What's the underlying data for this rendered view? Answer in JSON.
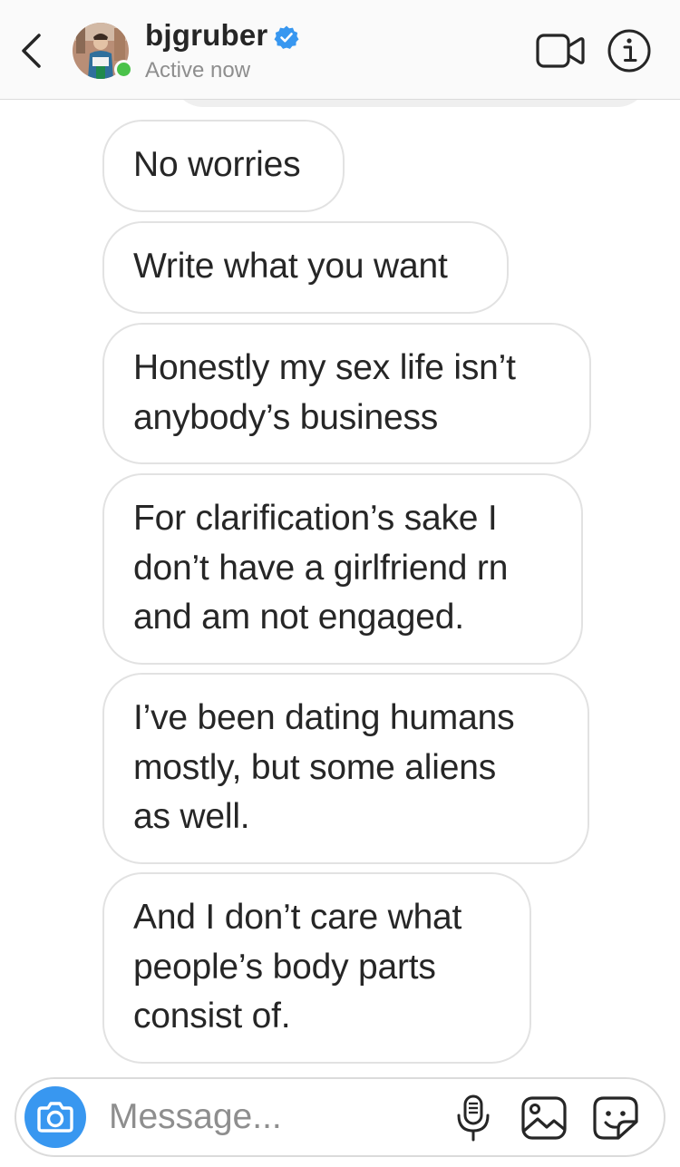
{
  "header": {
    "username": "bjgruber",
    "status": "Active now",
    "verified": true
  },
  "messages": [
    "No worries",
    "Write what you want",
    "Honestly my sex life isn’t\nanybody’s business",
    "For clarification’s sake I\ndon’t have a girlfriend rn\nand am not engaged.",
    "I’ve been dating humans\nmostly, but some aliens\nas well.",
    "And I don’t care what\npeople’s body parts\nconsist of."
  ],
  "composer": {
    "placeholder": "Message..."
  },
  "icons": {
    "back": "chevron-left-icon",
    "verified": "verified-badge-icon",
    "video": "video-camera-icon",
    "info": "info-icon",
    "camera": "camera-icon",
    "mic": "microphone-icon",
    "gallery": "image-icon",
    "sticker": "sticker-icon"
  },
  "colors": {
    "accent": "#3897f0",
    "online": "#4ac24a",
    "text": "#262626",
    "secondary_text": "#8e8e8e",
    "bubble_border": "#e2e2e2",
    "header_bg": "#fafafa"
  }
}
